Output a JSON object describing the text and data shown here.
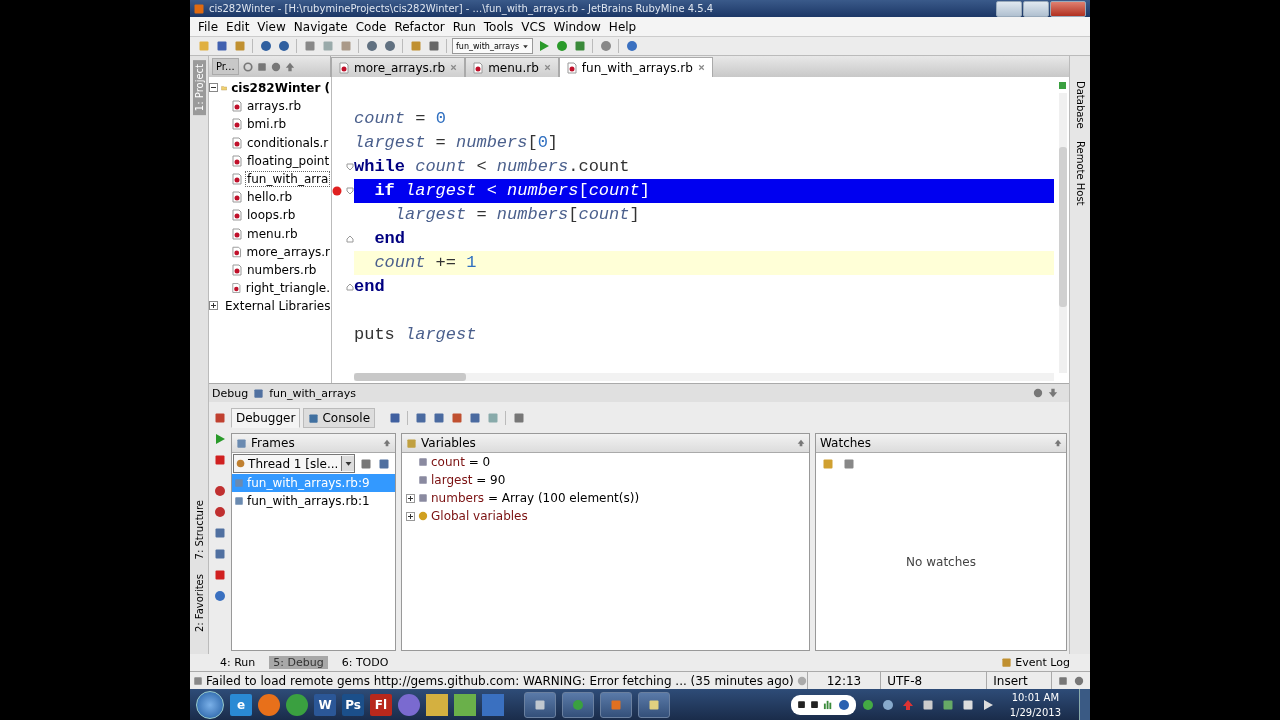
{
  "window": {
    "title": "cis282Winter - [H:\\rubymineProjects\\cis282Winter] - ...\\fun_with_arrays.rb - JetBrains RubyMine 4.5.4"
  },
  "menu": [
    "File",
    "Edit",
    "View",
    "Navigate",
    "Code",
    "Refactor",
    "Run",
    "Tools",
    "VCS",
    "Window",
    "Help"
  ],
  "toolbar": {
    "run_config": "fun_with_arrays"
  },
  "project_tab": {
    "label": "Pr..."
  },
  "editor_tabs": [
    {
      "label": "more_arrays.rb",
      "selected": false
    },
    {
      "label": "menu.rb",
      "selected": false
    },
    {
      "label": "fun_with_arrays.rb",
      "selected": true
    }
  ],
  "side_tabs_left": [
    {
      "label": "1: Project",
      "selected": true
    },
    {
      "label": "7: Structure",
      "selected": false
    },
    {
      "label": "2: Favorites",
      "selected": false
    }
  ],
  "side_tabs_right": [
    "Database",
    "Remote Host"
  ],
  "project_tree": [
    {
      "label": "cis282Winter (",
      "kind": "folder",
      "expanded": true,
      "selected": false,
      "children": [
        {
          "label": "arrays.rb",
          "kind": "file",
          "selected": false
        },
        {
          "label": "bmi.rb",
          "kind": "file",
          "selected": false
        },
        {
          "label": "conditionals.r",
          "kind": "file",
          "selected": false
        },
        {
          "label": "floating_point",
          "kind": "file",
          "selected": false
        },
        {
          "label": "fun_with_arra",
          "kind": "file",
          "selected": true
        },
        {
          "label": "hello.rb",
          "kind": "file",
          "selected": false
        },
        {
          "label": "loops.rb",
          "kind": "file",
          "selected": false
        },
        {
          "label": "menu.rb",
          "kind": "file",
          "selected": false
        },
        {
          "label": "more_arrays.r",
          "kind": "file",
          "selected": false
        },
        {
          "label": "numbers.rb",
          "kind": "file",
          "selected": false
        },
        {
          "label": "right_triangle.",
          "kind": "file",
          "selected": false
        }
      ]
    },
    {
      "label": "External Libraries",
      "kind": "library",
      "expanded": false,
      "selected": false
    }
  ],
  "editor": {
    "blocks": [
      {
        "lines": [
          {
            "tokens": [
              {
                "text": "count",
                "kind": "var"
              },
              {
                "text": " = ",
                "kind": "op"
              },
              {
                "text": "0",
                "kind": "num"
              }
            ],
            "breakpoint": false,
            "current": false,
            "fold_start": false,
            "fold_end": false
          },
          {
            "tokens": [
              {
                "text": "largest",
                "kind": "var"
              },
              {
                "text": " = ",
                "kind": "op"
              },
              {
                "text": "numbers",
                "kind": "var"
              },
              {
                "text": "[",
                "kind": "op"
              },
              {
                "text": "0",
                "kind": "num"
              },
              {
                "text": "]",
                "kind": "op"
              }
            ],
            "breakpoint": false,
            "current": false,
            "fold_start": false,
            "fold_end": false
          },
          {
            "tokens": [
              {
                "text": "while",
                "kind": "kw"
              },
              {
                "text": " count",
                "kind": "var"
              },
              {
                "text": " < ",
                "kind": "op"
              },
              {
                "text": "numbers",
                "kind": "var"
              },
              {
                "text": ".count",
                "kind": "op"
              }
            ],
            "breakpoint": false,
            "current": false,
            "fold_start": true,
            "fold_end": false
          },
          {
            "tokens": [
              {
                "text": "  if",
                "kind": "kw"
              },
              {
                "text": " largest",
                "kind": "var"
              },
              {
                "text": " < ",
                "kind": "op"
              },
              {
                "text": "numbers",
                "kind": "var"
              },
              {
                "text": "[",
                "kind": "op"
              },
              {
                "text": "count",
                "kind": "var"
              },
              {
                "text": "]",
                "kind": "op"
              }
            ],
            "breakpoint": true,
            "current": false,
            "fold_start": true,
            "fold_end": false
          },
          {
            "tokens": [
              {
                "text": "    largest",
                "kind": "var"
              },
              {
                "text": " = ",
                "kind": "op"
              },
              {
                "text": "numbers",
                "kind": "var"
              },
              {
                "text": "[",
                "kind": "op"
              },
              {
                "text": "count",
                "kind": "var"
              },
              {
                "text": "]",
                "kind": "op"
              }
            ],
            "breakpoint": false,
            "current": false,
            "fold_start": false,
            "fold_end": false
          },
          {
            "tokens": [
              {
                "text": "  end",
                "kind": "kw"
              }
            ],
            "breakpoint": false,
            "current": false,
            "fold_start": false,
            "fold_end": true
          },
          {
            "tokens": [
              {
                "text": "  count",
                "kind": "var"
              },
              {
                "text": " += ",
                "kind": "op"
              },
              {
                "text": "1",
                "kind": "num"
              }
            ],
            "breakpoint": false,
            "current": true,
            "fold_start": false,
            "fold_end": false
          },
          {
            "tokens": [
              {
                "text": "end",
                "kind": "kw"
              }
            ],
            "breakpoint": false,
            "current": false,
            "fold_start": false,
            "fold_end": true
          }
        ]
      },
      {
        "lines": [
          {
            "tokens": [
              {
                "text": "puts ",
                "kind": "op"
              },
              {
                "text": "largest",
                "kind": "var"
              }
            ],
            "breakpoint": false,
            "current": false,
            "fold_start": false,
            "fold_end": false
          }
        ]
      }
    ]
  },
  "debug": {
    "title": "Debug",
    "config": "fun_with_arrays",
    "tabs": [
      {
        "label": "Debugger",
        "selected": true
      },
      {
        "label": "Console",
        "selected": false
      }
    ],
    "frames": {
      "title": "Frames",
      "thread": "Thread 1 [sle...",
      "items": [
        {
          "label": "fun_with_arrays.rb:9",
          "selected": true
        },
        {
          "label": "fun_with_arrays.rb:1",
          "selected": false
        }
      ]
    },
    "variables": {
      "title": "Variables",
      "items": [
        {
          "name": "count",
          "value": "= 0",
          "expandable": false
        },
        {
          "name": "largest",
          "value": "= 90",
          "expandable": false
        },
        {
          "name": "numbers",
          "value": "= Array (100 element(s))",
          "expandable": true
        },
        {
          "name": "Global variables",
          "expandable": true
        }
      ]
    },
    "watches": {
      "title": "Watches",
      "empty_text": "No watches"
    }
  },
  "tool_tabs": [
    {
      "label": "4: Run",
      "selected": false
    },
    {
      "label": "5: Debug",
      "selected": true
    },
    {
      "label": "6: TODO",
      "selected": false
    }
  ],
  "event_log": "Event Log",
  "status_bar": {
    "message": "Failed to load remote gems http://gems.github.com: WARNING:  Error fetching ... (35 minutes ago)",
    "position": "12:13",
    "encoding": "UTF-8",
    "mode": "Insert"
  },
  "taskbar": {
    "apps": [
      {
        "kind": "logo",
        "label": "e",
        "color": "#2a8ad4"
      },
      {
        "kind": "round",
        "color": "#e8701a"
      },
      {
        "kind": "round",
        "color": "#3aa040"
      },
      {
        "kind": "logo",
        "label": "W",
        "color": "#2b5797"
      },
      {
        "kind": "logo",
        "label": "Ps",
        "color": "#1b4f8a"
      },
      {
        "kind": "logo",
        "label": "Fl",
        "color": "#b8281c"
      },
      {
        "kind": "round",
        "color": "#7a6ad0"
      },
      {
        "kind": "square",
        "color": "#d4b040"
      },
      {
        "kind": "square",
        "color": "#6ab04a"
      },
      {
        "kind": "square",
        "color": "#3a70c0"
      }
    ],
    "time": "10:01 AM",
    "date": "1/29/2013"
  }
}
